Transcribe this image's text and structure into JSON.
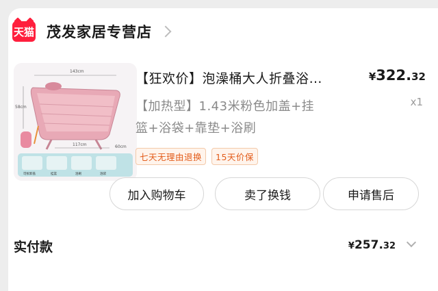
{
  "shop": {
    "badge_text": "天猫",
    "name": "茂发家居专营店",
    "badge_color": "#ff1f3d"
  },
  "product": {
    "title": "【狂欢价】泡澡桶大人折叠浴…",
    "spec_line1": "【加热型】1.43米粉色加盖+挂",
    "spec_line2": "篮+浴袋+靠垫+浴刷",
    "price_symbol": "¥",
    "price_integer": "322.",
    "price_decimal": "32",
    "quantity": "x1",
    "tags": [
      "七天无理由退换",
      "15天价保"
    ],
    "image": {
      "dim_top": "143cm",
      "dim_left": "58cm",
      "dim_bottom": "117cm",
      "dim_right": "60cm",
      "accessory_labels": [
        "可拆卸盖",
        "挂篮",
        "浴刷",
        "浴袋"
      ]
    }
  },
  "actions": {
    "add_cart": "加入购物车",
    "sell": "卖了换钱",
    "after_sales": "申请售后"
  },
  "payment": {
    "label": "实付款",
    "symbol": "¥",
    "integer": "257.",
    "decimal": "32"
  }
}
